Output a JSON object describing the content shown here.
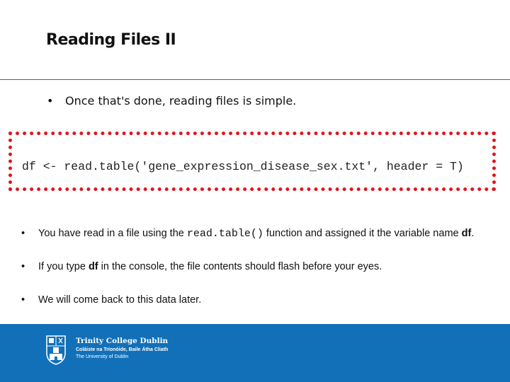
{
  "slide": {
    "title": "Reading Files II",
    "intro_bullet": "Once that's done, reading files is simple.",
    "bullet_glyph": "•",
    "code": "df <- read.table('gene_expression_disease_sex.txt', header = T)",
    "bullets": [
      {
        "part1": "You have read in a file using the ",
        "code": "read.table()",
        "part2": " function and assigned it the variable name ",
        "bold": "df",
        "part3": "."
      },
      {
        "part1": "If you type ",
        "bold": "df",
        "part2": " in the console, the file contents should flash before your eyes."
      },
      {
        "part1": "We will come back to this data later."
      }
    ]
  },
  "footer": {
    "logo_icon": "trinity-crest-icon",
    "name": "Trinity College Dublin",
    "irish_name": "Coláiste na Tríonóide, Baile Átha Cliath",
    "subtitle": "The University of Dublin"
  },
  "colors": {
    "footer_bg": "#1170b8",
    "code_border": "#e3141b",
    "divider": "#2f6f8f"
  }
}
